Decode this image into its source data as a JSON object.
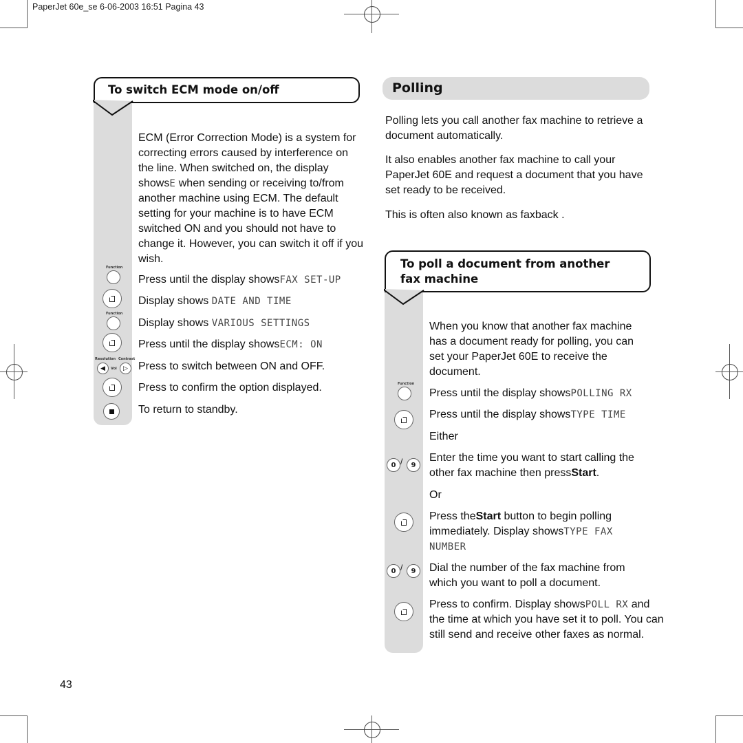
{
  "slug": "PaperJet 60e_se  6-06-2003  16:51  Pagina 43",
  "page_number": "43",
  "left": {
    "heading": "To switch ECM mode on/off",
    "intro": "ECM (Error Correction Mode) is a system for correcting errors caused by interference on the line. When switched on, the display shows",
    "intro_lcd": "E",
    "intro_cont": " when sending or receiving to/from another machine using ECM. The default setting for your machine is to have ECM switched ON and you should not have to change it. However, you can switch it off if you wish.",
    "steps": [
      {
        "key": "function-key",
        "key_label": "Function",
        "text": "Press until the display shows",
        "lcd": "FAX SET-UP"
      },
      {
        "key": "start-key",
        "text": "Display shows ",
        "lcd": "DATE AND TIME"
      },
      {
        "key": "function-key",
        "key_label": "Function",
        "text": "Display shows ",
        "lcd": "VARIOUS SETTINGS"
      },
      {
        "key": "start-key",
        "text": "Press until the display shows",
        "lcd": "ECM: ON"
      },
      {
        "key": "resolution-contrast-keys",
        "key_label_left": "Resolution",
        "key_label_right": "Contrast",
        "key_label_mid": "Vol",
        "text": "Press to switch between ON and OFF."
      },
      {
        "key": "start-key",
        "text": "Press to confirm the option displayed."
      },
      {
        "key": "stop-key",
        "text": "To return to standby."
      }
    ]
  },
  "right": {
    "heading": "Polling",
    "paragraphs": [
      "Polling lets you call another fax machine to retrieve a document automatically.",
      "It also enables another fax machine to call your PaperJet 60E and request a document that you have set ready to be received.",
      "This is often also known as  faxback ."
    ],
    "sub_heading": "To poll a document from another fax machine",
    "sub_intro": "When you know that another fax machine has a document ready for polling, you can set your PaperJet 60E to receive the document.",
    "steps": [
      {
        "key": "function-key",
        "key_label": "Function",
        "text": "Press until the display shows",
        "lcd": "POLLING RX"
      },
      {
        "key": "start-key",
        "text": "Press until the display shows",
        "lcd": "TYPE TIME"
      },
      {
        "text": "Either"
      },
      {
        "key": "number-keys",
        "key_from": "0",
        "key_to": "9",
        "text": "Enter the time you want to start calling the other fax machine then press",
        "bold": "Start",
        "tail": "."
      },
      {
        "text": "Or"
      },
      {
        "key": "start-key",
        "text_pre": "Press the",
        "bold": "Start",
        "text": " button to begin polling immediately. Display shows",
        "lcd": "TYPE FAX NUMBER"
      },
      {
        "key": "number-keys",
        "key_from": "0",
        "key_to": "9",
        "text": "Dial the number of the fax machine from which you want to poll a document."
      },
      {
        "key": "start-key",
        "text": "Press to confirm. Display shows",
        "lcd": "POLL RX",
        "tail": " and the time at which you have set it to poll. You can still send and receive other faxes as normal."
      }
    ]
  }
}
